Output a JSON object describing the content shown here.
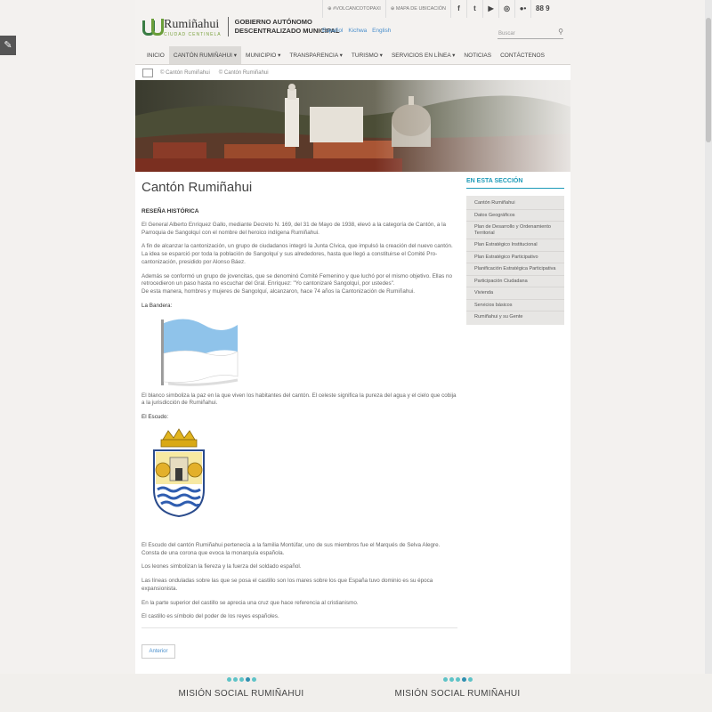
{
  "header": {
    "logo_name": "Rumiñahui",
    "logo_sub": "CIUDAD CENTINELA",
    "gov_line1": "GOBIERNO AUTÓNOMO",
    "gov_line2": "DESCENTRALIZADO MUNICIPAL",
    "top_links": [
      "#VOLCANCOTOPAXI",
      "MAPA DE UBICACIÓN"
    ],
    "social_icons": [
      "f",
      "t",
      "▶",
      "◎",
      "●•"
    ],
    "counter": "88 9",
    "languages": [
      "Español",
      "Kichwa",
      "English"
    ],
    "search_placeholder": "Buscar"
  },
  "nav": [
    "INICIO",
    "CANTÓN RUMIÑAHUI ▾",
    "MUNICIPIO ▾",
    "TRANSPARENCIA ▾",
    "TURISMO ▾",
    "SERVICIOS EN LÍNEA ▾",
    "NOTICIAS",
    "CONTÁCTENOS"
  ],
  "breadcrumb": [
    "© Cantón Rumiñahui",
    "© Cantón Rumiñahui"
  ],
  "main": {
    "title": "Cantón Rumiñahui",
    "section_head": "RESEÑA HISTÓRICA",
    "p1": "El General Alberto Enríquez Gallo, mediante Decreto N. 169, del 31 de Mayo de 1938, elevó a la categoría de Cantón, a la Parroquia de Sangolquí con el nombre del heroico indígena Rumiñahui.",
    "p2": "A fin de alcanzar la cantonización, un grupo de ciudadanos integró la Junta Cívica, que impulsó la creación del nuevo cantón. La idea se esparció por toda la población de Sangolquí y sus alrededores, hasta que llegó a constituirse el Comité Pro-cantonización, presidido por Alonso Báez.",
    "p3": "Además se conformó un grupo de jovencitas, que se denominó Comité Femenino y que luchó por el mismo objetivo. Ellas no retrocedieron un paso hasta no escuchar del Gral. Enríquez: \"Yo cantonizaré Sangolquí, por ustedes\".",
    "p3b": "De esta manera, hombres y mujeres de Sangolquí, alcanzaron, hace 74 años la Cantonización de Rumiñahui.",
    "flag_head": "La Bandera:",
    "flag_text": "El blanco simboliza la paz en la que viven los habitantes del cantón. El celeste significa la pureza del agua y el cielo que cobija a la jurisdicción de Rumiñahui.",
    "shield_head": "El Escudo:",
    "s1": "El Escudo del cantón Rumiñahui pertenecía a la familia Montúfar, uno de sus miembros fue el Marqués de Selva Alegre. Consta de una corona que evoca la monarquía española.",
    "s2": "Los leones simbolizan la fiereza y la fuerza del soldado español.",
    "s3": "Las líneas onduladas sobre las que se posa el castillo son los mares sobre los que España tuvo dominio es su época expansionista.",
    "s4": "En la parte superior del castillo se aprecia una cruz que hace referencia al cristianismo.",
    "s5": "El castillo es símbolo del poder de los reyes españoles.",
    "prev": "Anterior"
  },
  "sidebar": {
    "title": "EN ESTA SECCIÓN",
    "items": [
      "Cantón Rumiñahui",
      "Datos Geográficos",
      "Plan de Desarrollo y Ordenamiento Territorial",
      "Plan Estratégico Institucional",
      "Plan Estratégico Participativo",
      "Planificación Estratégica Participativa",
      "Participación Ciudadana",
      "Vivienda",
      "Servicios básicos",
      "Rumiñahui y su Gente"
    ]
  },
  "footer": {
    "left_title": "MISIÓN SOCIAL RUMIÑAHUI",
    "right_title": "MISIÓN SOCIAL RUMIÑAHUI"
  },
  "colors": {
    "accent": "#1c9ab8",
    "flag_blue": "#8fc3ea",
    "link": "#4a8fcc"
  }
}
